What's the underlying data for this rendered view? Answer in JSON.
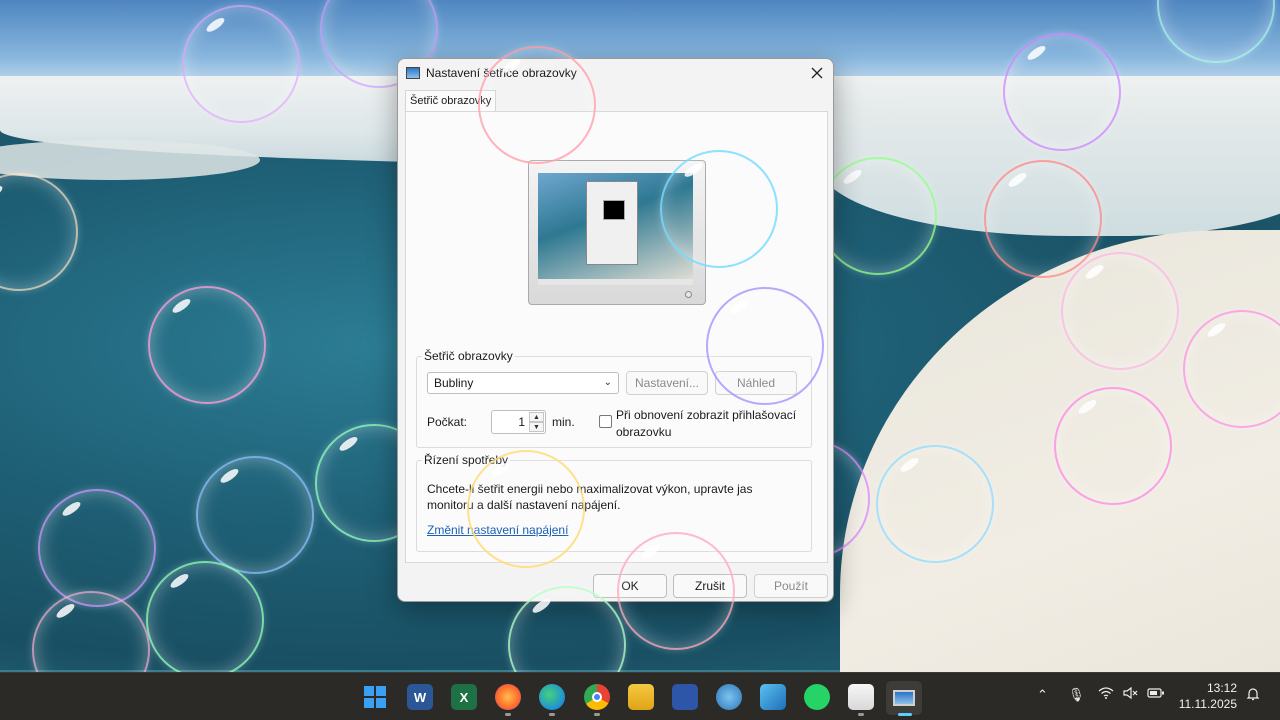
{
  "dialog": {
    "title": "Nastavení šetřiče obrazovky",
    "tab_label": "Šetřič obrazovky",
    "screensaver_group": {
      "title": "Šetřič obrazovky",
      "selected": "Bubliny",
      "settings_button": "Nastavení...",
      "preview_button": "Náhled",
      "wait_label": "Počkat:",
      "wait_value": "1",
      "wait_unit": "min.",
      "resume_checkbox_label_line1": "Při obnovení zobrazit přihlašovací",
      "resume_checkbox_label_line2": "obrazovku",
      "resume_checked": false
    },
    "power_group": {
      "title": "Řízení spotřeby",
      "text_line1": "Chcete-li šetřit energii nebo maximalizovat výkon, upravte jas",
      "text_line2": "monitoru a další nastavení napájení.",
      "link": "Změnit nastavení napájení"
    },
    "buttons": {
      "ok": "OK",
      "cancel": "Zrušit",
      "apply": "Použít"
    }
  },
  "taskbar": {
    "apps": [
      "start-icon",
      "word-icon",
      "excel-icon",
      "firefox-icon",
      "edge-icon",
      "chrome-icon",
      "file-explorer-icon",
      "save-app-icon",
      "globe-app-icon",
      "pen-app-icon",
      "whatsapp-icon",
      "photo-app-icon",
      "screensaver-settings-icon"
    ],
    "word_glyph": "W",
    "excel_glyph": "X",
    "time": "13:12",
    "date": "11.11.2025"
  },
  "colors": {
    "link": "#1a5fb4",
    "taskbar": "#2b2a27"
  }
}
